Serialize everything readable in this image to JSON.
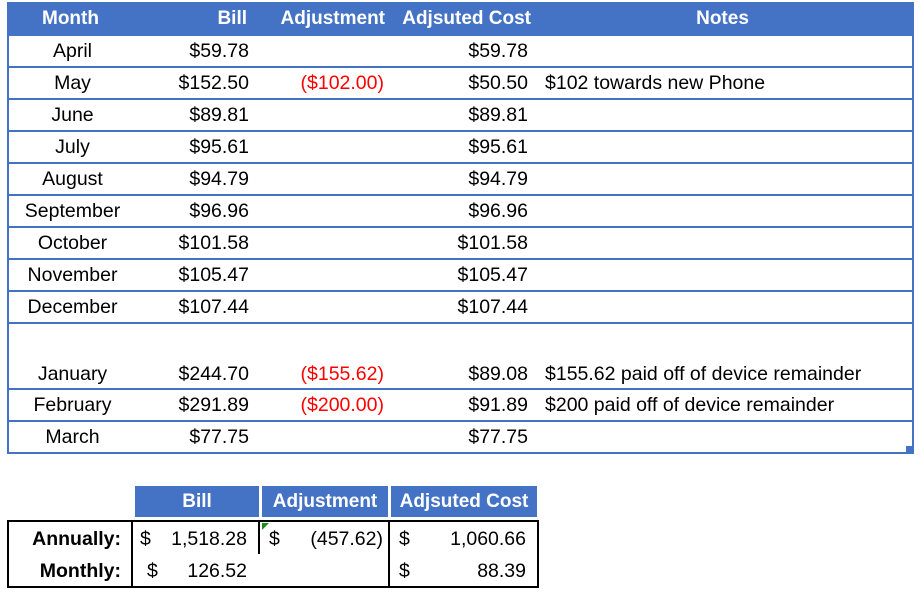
{
  "main_table": {
    "headers": {
      "month": "Month",
      "bill": "Bill",
      "adjustment": "Adjustment",
      "adjusted_cost": "Adjsuted Cost",
      "notes": "Notes"
    },
    "rows": [
      {
        "month": "April",
        "bill": "$59.78",
        "adjustment": "",
        "adjusted_cost": "$59.78",
        "notes": ""
      },
      {
        "month": "May",
        "bill": "$152.50",
        "adjustment": "($102.00)",
        "adjusted_cost": "$50.50",
        "notes": "$102 towards new Phone"
      },
      {
        "month": "June",
        "bill": "$89.81",
        "adjustment": "",
        "adjusted_cost": "$89.81",
        "notes": ""
      },
      {
        "month": "July",
        "bill": "$95.61",
        "adjustment": "",
        "adjusted_cost": "$95.61",
        "notes": ""
      },
      {
        "month": "August",
        "bill": "$94.79",
        "adjustment": "",
        "adjusted_cost": "$94.79",
        "notes": ""
      },
      {
        "month": "September",
        "bill": "$96.96",
        "adjustment": "",
        "adjusted_cost": "$96.96",
        "notes": ""
      },
      {
        "month": "October",
        "bill": "$101.58",
        "adjustment": "",
        "adjusted_cost": "$101.58",
        "notes": ""
      },
      {
        "month": "November",
        "bill": "$105.47",
        "adjustment": "",
        "adjusted_cost": "$105.47",
        "notes": ""
      },
      {
        "month": "December",
        "bill": "$107.44",
        "adjustment": "",
        "adjusted_cost": "$107.44",
        "notes": ""
      },
      {
        "month": "January",
        "bill": "$244.70",
        "adjustment": "($155.62)",
        "adjusted_cost": "$89.08",
        "notes": "$155.62 paid off of device remainder"
      },
      {
        "month": "February",
        "bill": "$291.89",
        "adjustment": "($200.00)",
        "adjusted_cost": "$91.89",
        "notes": "$200 paid off of device remainder"
      },
      {
        "month": "March",
        "bill": "$77.75",
        "adjustment": "",
        "adjusted_cost": "$77.75",
        "notes": ""
      }
    ]
  },
  "summary_table": {
    "headers": {
      "bill": "Bill",
      "adjustment": "Adjustment",
      "adjusted_cost": "Adjsuted Cost"
    },
    "rows": [
      {
        "label": "Annually:",
        "bill_sym": "$",
        "bill": "1,518.28",
        "adj_sym": "$",
        "adjustment": "(457.62)",
        "cost_sym": "$",
        "adjusted_cost": "1,060.66"
      },
      {
        "label": "Monthly:",
        "bill_sym": "$",
        "bill": "126.52",
        "adj_sym": "",
        "adjustment": "",
        "cost_sym": "$",
        "adjusted_cost": "88.39"
      }
    ]
  },
  "colors": {
    "header_bg": "#4472C4",
    "negative": "#ff0000",
    "comment_marker": "#1a8a1a"
  }
}
